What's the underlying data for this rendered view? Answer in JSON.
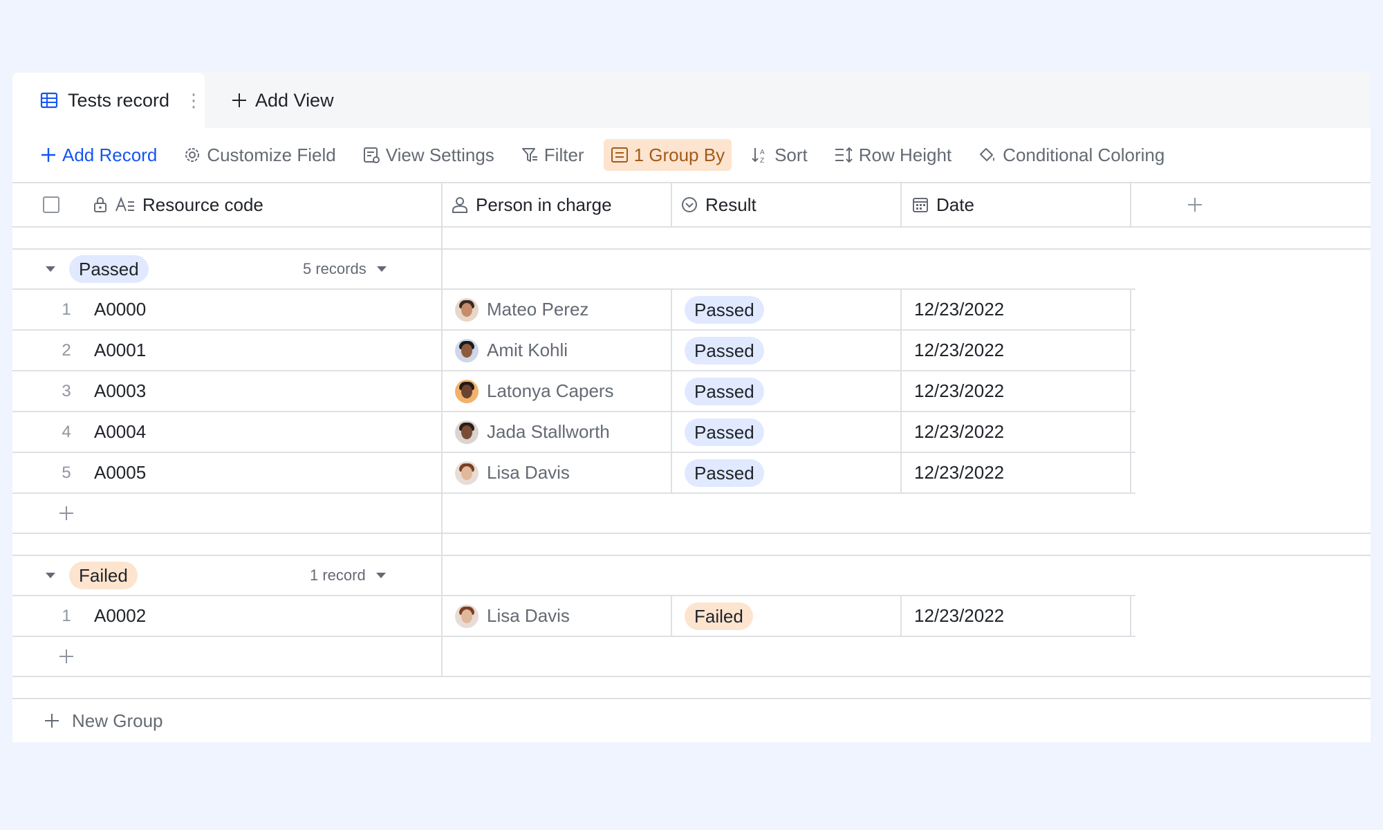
{
  "tabs": {
    "active_label": "Tests record",
    "add_view_label": "Add View"
  },
  "toolbar": {
    "add_record": "Add Record",
    "customize_field": "Customize Field",
    "view_settings": "View Settings",
    "filter": "Filter",
    "group_by": "1 Group By",
    "sort": "Sort",
    "row_height": "Row Height",
    "conditional_coloring": "Conditional Coloring"
  },
  "columns": {
    "resource_code": "Resource code",
    "person_in_charge": "Person in charge",
    "result": "Result",
    "date": "Date"
  },
  "groups": [
    {
      "name": "Passed",
      "count_label": "5 records",
      "rows": [
        {
          "num": "1",
          "code": "A0000",
          "person": "Mateo Perez",
          "result": "Passed",
          "date": "12/23/2022"
        },
        {
          "num": "2",
          "code": "A0001",
          "person": "Amit Kohli",
          "result": "Passed",
          "date": "12/23/2022"
        },
        {
          "num": "3",
          "code": "A0003",
          "person": "Latonya Capers",
          "result": "Passed",
          "date": "12/23/2022"
        },
        {
          "num": "4",
          "code": "A0004",
          "person": "Jada Stallworth",
          "result": "Passed",
          "date": "12/23/2022"
        },
        {
          "num": "5",
          "code": "A0005",
          "person": "Lisa Davis",
          "result": "Passed",
          "date": "12/23/2022"
        }
      ]
    },
    {
      "name": "Failed",
      "count_label": "1 record",
      "rows": [
        {
          "num": "1",
          "code": "A0002",
          "person": "Lisa Davis",
          "result": "Failed",
          "date": "12/23/2022"
        }
      ]
    }
  ],
  "footer": {
    "new_group": "New Group"
  },
  "colors": {
    "accent": "#1456f0",
    "passed_tag": "#e0e9ff",
    "failed_tag": "#fde4cf",
    "page_bg": "#f0f4fe"
  }
}
